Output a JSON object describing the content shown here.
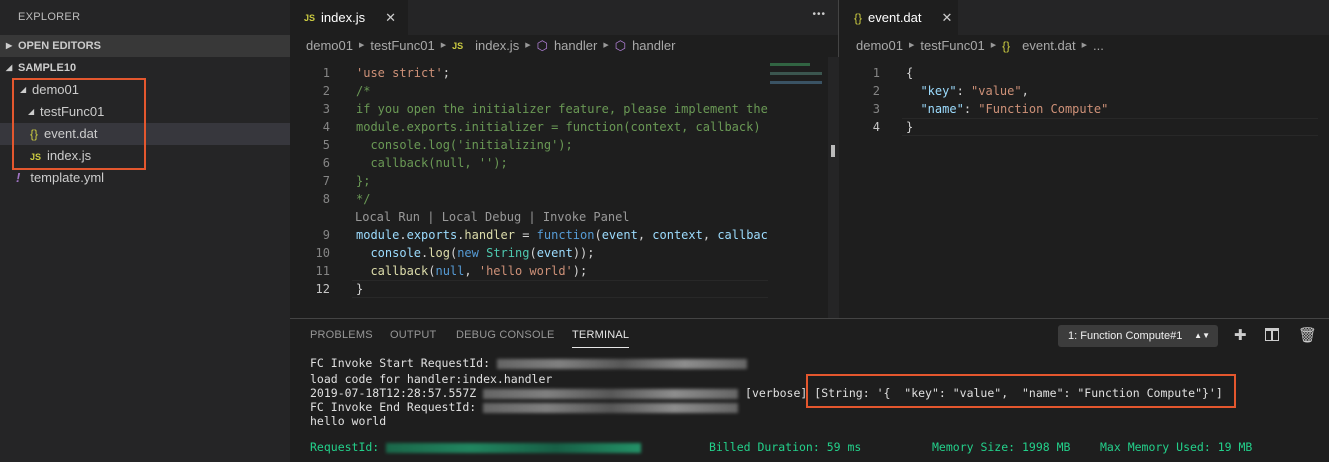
{
  "sidebar": {
    "title": "EXPLORER",
    "open_editors": "OPEN EDITORS",
    "workspace": "SAMPLE10",
    "tree": [
      {
        "label": "demo01",
        "icon": "folder-open"
      },
      {
        "label": "testFunc01",
        "icon": "folder-open"
      },
      {
        "label": "event.dat",
        "icon": "json-braces-icon",
        "selected": true
      },
      {
        "label": "index.js",
        "icon": "js-icon"
      },
      {
        "label": "template.yml",
        "icon": "yaml-exclamation-icon"
      }
    ]
  },
  "editor_left": {
    "tab": "index.js",
    "breadcrumb": [
      "demo01",
      "testFunc01",
      "index.js",
      "handler",
      "handler"
    ],
    "more": "•••",
    "lens": "Local Run | Local Debug | Invoke Panel",
    "lines": [
      [
        [
          "'use strict'",
          "str"
        ],
        [
          ";",
          "pun"
        ]
      ],
      [
        [
          "/*",
          "com"
        ]
      ],
      [
        [
          "if you open the initializer feature, please implement the",
          "com"
        ]
      ],
      [
        [
          "module.exports.initializer = function(context, callback) ",
          "com"
        ]
      ],
      [
        [
          "  console.log('initializing');",
          "com"
        ]
      ],
      [
        [
          "  callback(null, '');",
          "com"
        ]
      ],
      [
        [
          "};",
          "com"
        ]
      ],
      [
        [
          "*/",
          "com"
        ]
      ],
      [
        [
          "module",
          "var"
        ],
        [
          ".",
          "pun"
        ],
        [
          "exports",
          "var"
        ],
        [
          ".",
          "pun"
        ],
        [
          "handler",
          "fn"
        ],
        [
          " = ",
          "pun"
        ],
        [
          "function",
          "kw"
        ],
        [
          "(",
          "pun"
        ],
        [
          "event",
          "var"
        ],
        [
          ", ",
          "pun"
        ],
        [
          "context",
          "var"
        ],
        [
          ", ",
          "pun"
        ],
        [
          "callbac",
          "var"
        ]
      ],
      [
        [
          "  ",
          "pun"
        ],
        [
          "console",
          "var"
        ],
        [
          ".",
          "pun"
        ],
        [
          "log",
          "fn"
        ],
        [
          "(",
          "pun"
        ],
        [
          "new",
          "kw"
        ],
        [
          " ",
          "pun"
        ],
        [
          "String",
          "cls"
        ],
        [
          "(",
          "pun"
        ],
        [
          "event",
          "var"
        ],
        [
          "));",
          "pun"
        ]
      ],
      [
        [
          "  ",
          "pun"
        ],
        [
          "callback",
          "fn"
        ],
        [
          "(",
          "pun"
        ],
        [
          "null",
          "kw"
        ],
        [
          ", ",
          "pun"
        ],
        [
          "'hello world'",
          "str"
        ],
        [
          ");",
          "pun"
        ]
      ],
      [
        [
          "}",
          "pun"
        ]
      ]
    ]
  },
  "editor_right": {
    "tab": "event.dat",
    "breadcrumb": [
      "demo01",
      "testFunc01",
      "event.dat",
      "..."
    ],
    "lines": [
      [
        [
          "{",
          "pun"
        ]
      ],
      [
        [
          "  ",
          "pun"
        ],
        [
          "\"key\"",
          "key"
        ],
        [
          ": ",
          "pun"
        ],
        [
          "\"value\"",
          "str"
        ],
        [
          ",",
          "pun"
        ]
      ],
      [
        [
          "  ",
          "pun"
        ],
        [
          "\"name\"",
          "key"
        ],
        [
          ": ",
          "pun"
        ],
        [
          "\"Function Compute\"",
          "str"
        ]
      ],
      [
        [
          "}",
          "pun"
        ]
      ]
    ]
  },
  "panel": {
    "tabs": [
      "PROBLEMS",
      "OUTPUT",
      "DEBUG CONSOLE",
      "TERMINAL"
    ],
    "active_tab": "TERMINAL",
    "terminal_select": "1: Function Compute#1",
    "terminal": {
      "l1": "FC Invoke Start RequestId: ",
      "l2": "load code for handler:index.handler",
      "l3a": "2019-07-18T12:28:57.557Z ",
      "l3b": " [verbose] ",
      "l3c": "[String: '{  \"key\": \"value\",  \"name\": \"Function Compute\"}']",
      "l4": "FC Invoke End RequestId: ",
      "l5": "hello world",
      "summary": {
        "request": "RequestId: ",
        "billed": "Billed Duration: 59 ms",
        "mem": "Memory Size: 1998 MB",
        "maxmem": "Max Memory Used: 19 MB"
      }
    }
  },
  "colors": {
    "highlight_box": "#e4572e",
    "terminal_green": "#23d18b"
  }
}
